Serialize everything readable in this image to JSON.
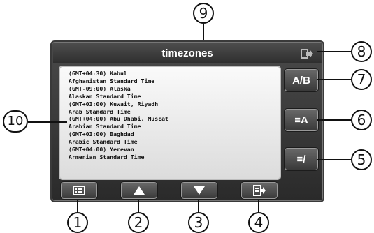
{
  "window": {
    "title": "timezones"
  },
  "timezones": [
    "(GMT+04:30) Kabul",
    "Afghanistan Standard Time",
    "(GMT-09:00) Alaska",
    "Alaskan Standard Time",
    "(GMT+03:00) Kuwait, Riyadh",
    "Arab Standard Time",
    "(GMT+04:00) Abu Dhabi, Muscat",
    "Arabian Standard Time",
    "(GMT+03:00) Baghdad",
    "Arabic Standard Time",
    "(GMT+04:00) Yerevan",
    "Armenian Standard Time"
  ],
  "side_buttons": {
    "ab_label": "A/B",
    "sort_alpha_label": "≡A",
    "sort_offset_label": "≡/"
  },
  "icons": {
    "exit": "exit-icon",
    "list": "list-icon",
    "up": "arrow-up-icon",
    "down": "arrow-down-icon",
    "select": "select-icon"
  },
  "callouts": [
    "1",
    "2",
    "3",
    "4",
    "5",
    "6",
    "7",
    "8",
    "9",
    "10"
  ],
  "colors": {
    "frame": "#3a3a3a",
    "title_text": "#ffffff",
    "list_bg": "#f2f2f2",
    "list_text": "#111111"
  }
}
